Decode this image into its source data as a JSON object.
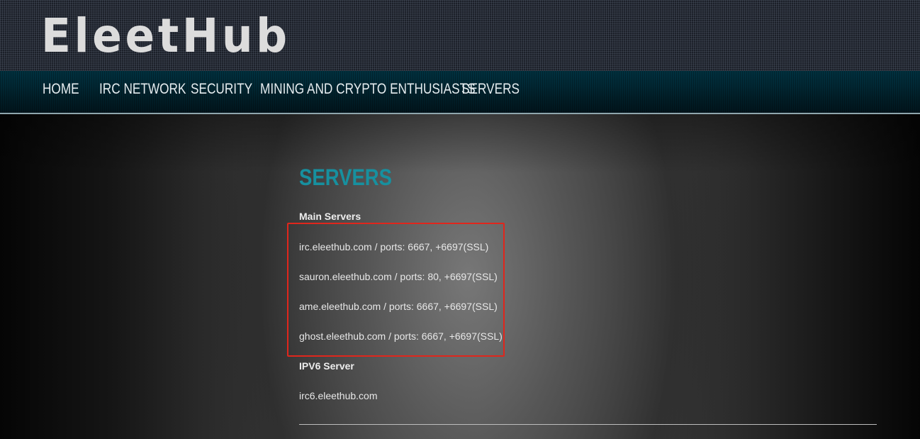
{
  "site": {
    "logo_text": "EleetHub"
  },
  "nav": {
    "items": [
      {
        "label": "HOME"
      },
      {
        "label": "IRC NETWORK"
      },
      {
        "label": "SECURITY"
      },
      {
        "label": "MINING AND CRYPTO ENTHUSIASTS"
      },
      {
        "label": "SERVERS"
      }
    ]
  },
  "content": {
    "title": "SERVERS",
    "main_servers_heading": "Main Servers",
    "main_servers": [
      "irc.eleethub.com / ports: 6667, +6697(SSL)",
      "sauron.eleethub.com / ports: 80, +6697(SSL)",
      "ame.eleethub.com / ports: 6667, +6697(SSL)",
      "ghost.eleethub.com / ports: 6667, +6697(SSL)"
    ],
    "ipv6_heading": "IPV6 Server",
    "ipv6_servers": [
      "irc6.eleethub.com"
    ]
  },
  "colors": {
    "title_accent": "#17909f",
    "highlight_border": "#e0261c",
    "nav_band": "#0f6b7a"
  }
}
